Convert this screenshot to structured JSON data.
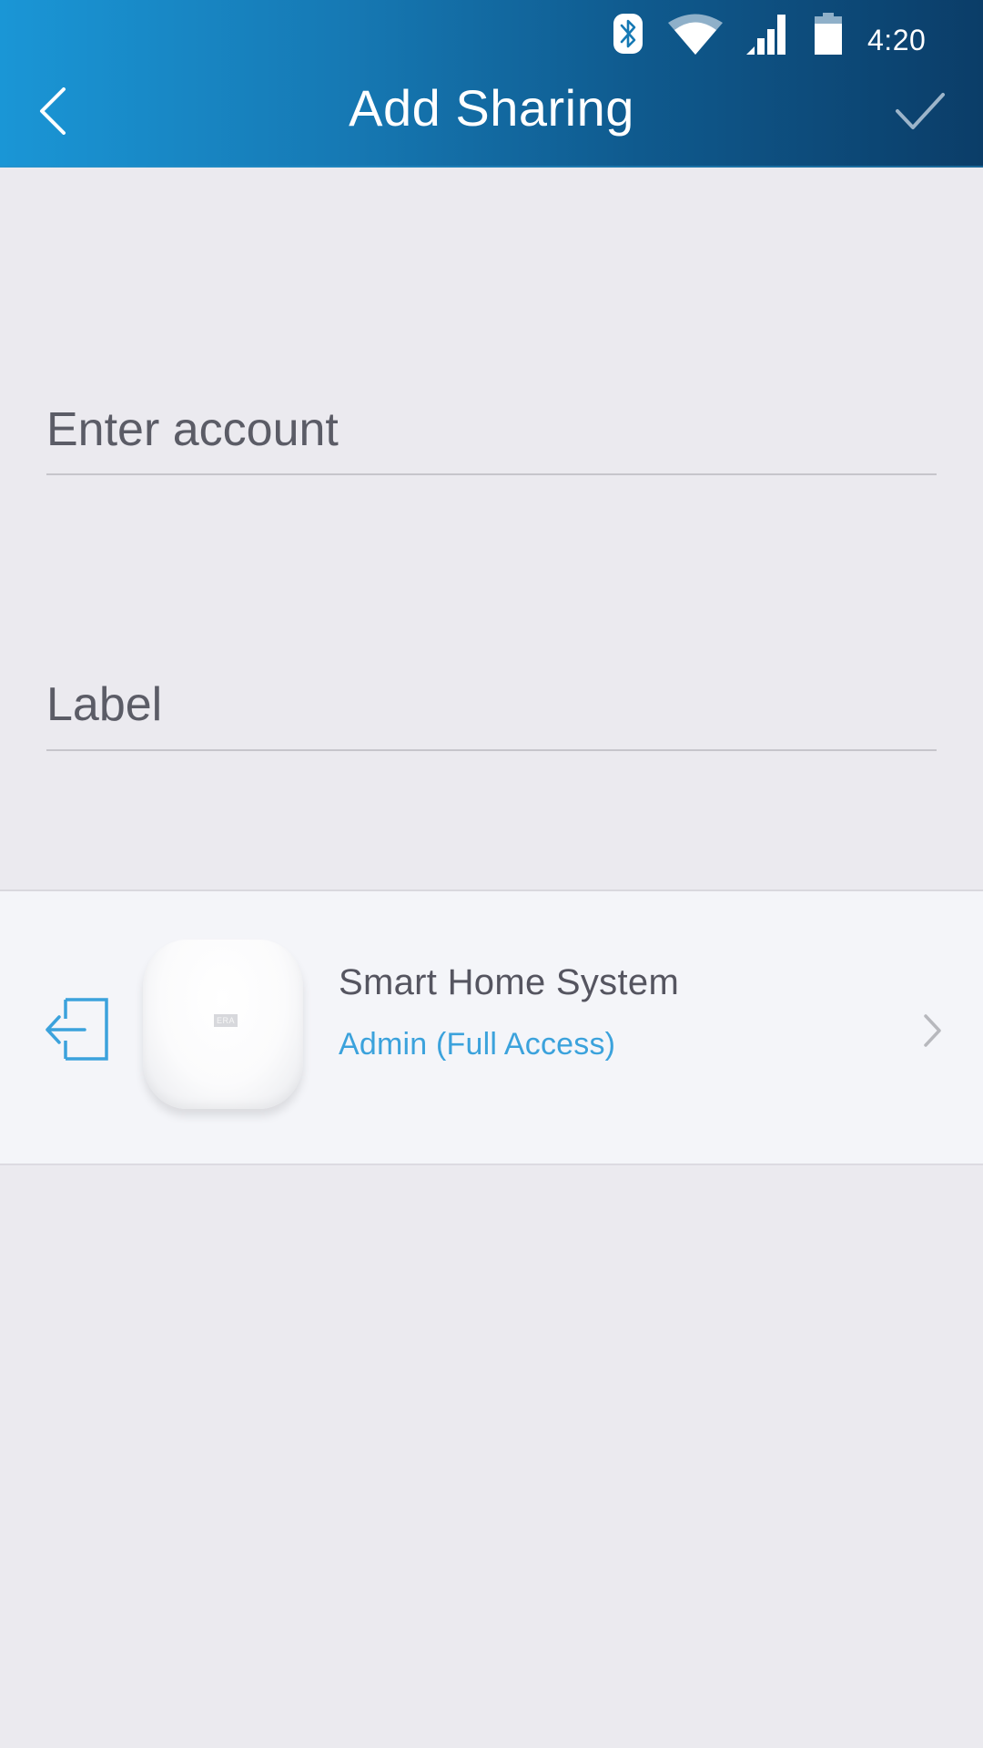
{
  "status_bar": {
    "time": "4:20",
    "icons": [
      "bluetooth-icon",
      "wifi-icon",
      "cell-signal-icon",
      "battery-icon"
    ]
  },
  "header": {
    "title": "Add Sharing",
    "back_icon": "chevron-left-icon",
    "confirm_icon": "checkmark-icon",
    "gradient_start": "#1a96d6",
    "gradient_end": "#0b3d68"
  },
  "form": {
    "account": {
      "placeholder": "Enter account",
      "value": ""
    },
    "label": {
      "placeholder": "Label",
      "value": ""
    }
  },
  "device": {
    "name": "Smart Home System",
    "access": "Admin (Full Access)",
    "badge": "ERA",
    "leading_icon": "exit-icon",
    "trailing_icon": "chevron-right-icon",
    "accent_color": "#3ba2dc"
  }
}
